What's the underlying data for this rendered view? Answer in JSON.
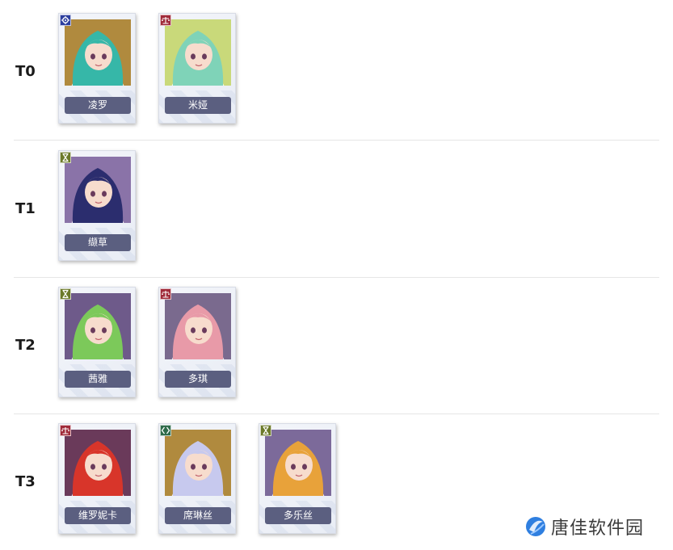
{
  "tiers": [
    {
      "label": "T0",
      "characters": [
        {
          "name": "凌罗",
          "class_icon": "gear-class-icon",
          "class_color": "#2d3f9e",
          "hair": "#36b7a8",
          "bg": "#b08a3e"
        },
        {
          "name": "米娅",
          "class_icon": "scales-class-icon",
          "class_color": "#a02b3a",
          "hair": "#7fd3b8",
          "bg": "#c9d97a"
        }
      ]
    },
    {
      "label": "T1",
      "characters": [
        {
          "name": "缬草",
          "class_icon": "hourglass-class-icon",
          "class_color": "#6c7a2a",
          "hair": "#2b2d6e",
          "bg": "#8a73a8"
        }
      ]
    },
    {
      "label": "T2",
      "characters": [
        {
          "name": "茜雅",
          "class_icon": "hourglass-class-icon",
          "class_color": "#6c7a2a",
          "hair": "#7cc95a",
          "bg": "#6e5a8a"
        },
        {
          "name": "多琪",
          "class_icon": "scales-class-icon",
          "class_color": "#a02b3a",
          "hair": "#e89aa8",
          "bg": "#7a6a8e"
        }
      ]
    },
    {
      "label": "T3",
      "characters": [
        {
          "name": "维罗妮卡",
          "class_icon": "scales-class-icon",
          "class_color": "#a02b3a",
          "hair": "#d8352a",
          "bg": "#6a3a5a"
        },
        {
          "name": "席琳丝",
          "class_icon": "chevrons-class-icon",
          "class_color": "#2e6b4a",
          "hair": "#c7c9ee",
          "bg": "#b08a3e"
        },
        {
          "name": "多乐丝",
          "class_icon": "hourglass-class-icon",
          "class_color": "#6c7a2a",
          "hair": "#e8a23a",
          "bg": "#7c6a9a"
        }
      ]
    }
  ],
  "watermark": {
    "text": "唐佳软件园",
    "logo_icon": "tangjia-logo-icon",
    "logo_color": "#2f7fe0"
  }
}
